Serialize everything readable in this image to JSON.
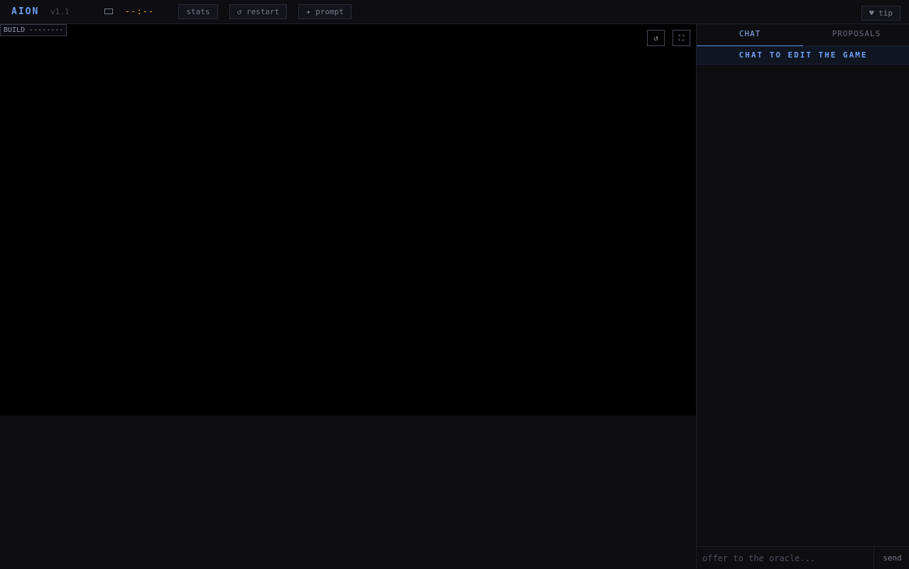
{
  "header": {
    "brand": "AION",
    "version": "v1.1",
    "timer": "--:--",
    "buttons": {
      "stats": "stats",
      "restart": "↺ restart",
      "prompt": "✦ prompt",
      "tip": "♥ tip"
    },
    "icons": {
      "display": "rectangle-icon"
    }
  },
  "game": {
    "build_label": "BUILD --------",
    "controls": {
      "reload": "↺",
      "fullscreen": "⛶"
    }
  },
  "sidebar": {
    "tabs": [
      {
        "label": "CHAT",
        "active": true
      },
      {
        "label": "PROPOSALS",
        "active": false
      }
    ],
    "banner": "CHAT TO EDIT THE GAME",
    "input_placeholder": "offer to the oracle...",
    "input_value": "",
    "send_label": "send"
  },
  "colors": {
    "accent": "#6fa0f0",
    "timer": "#e0a030",
    "background": "#0c0c11"
  }
}
